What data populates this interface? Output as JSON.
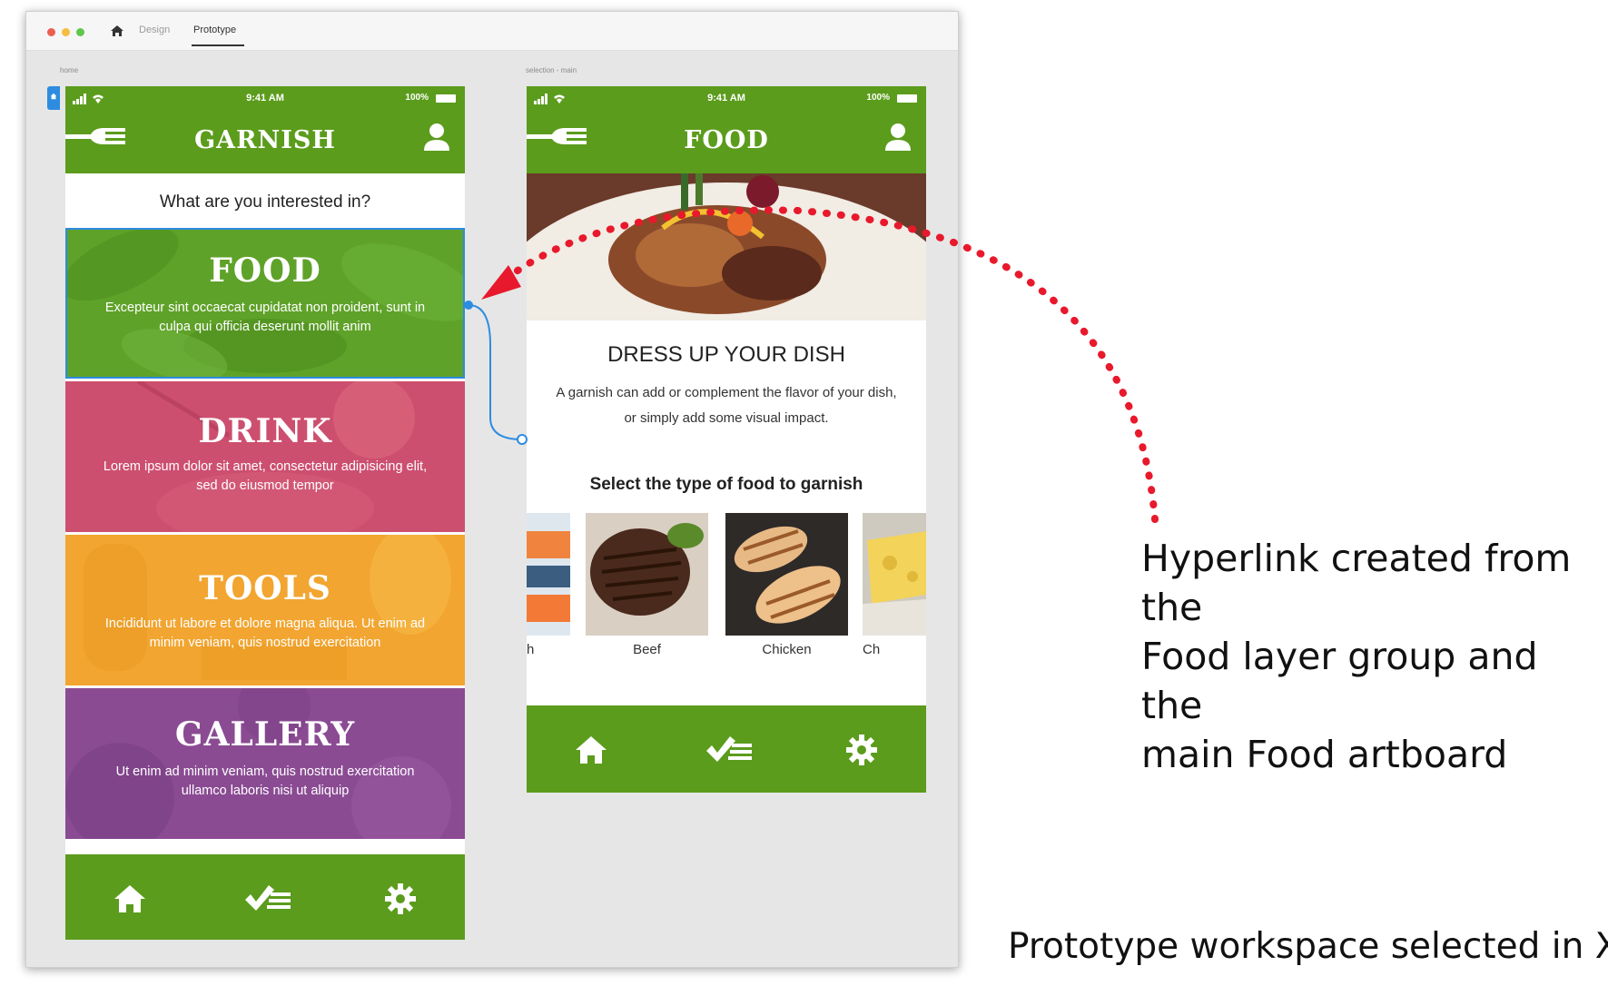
{
  "window": {
    "tabs": [
      "Design",
      "Prototype"
    ],
    "active_tab": "Prototype"
  },
  "artboards": {
    "home_name": "home",
    "food_name": "selection - main"
  },
  "status_bar": {
    "time": "9:41 AM",
    "battery": "100%"
  },
  "home_screen": {
    "title": "GARNISH",
    "question": "What are you interested in?",
    "tiles": [
      {
        "title": "FOOD",
        "desc": "Excepteur sint occaecat cupidatat non proident, sunt in culpa qui officia deserunt mollit anim",
        "color": "#5fa229"
      },
      {
        "title": "DRINK",
        "desc": "Lorem ipsum dolor sit amet, consectetur adipisicing elit, sed do eiusmod tempor",
        "color": "#cd4f6f"
      },
      {
        "title": "TOOLS",
        "desc": "Incididunt ut labore et dolore magna aliqua. Ut enim ad minim veniam, quis nostrud exercitation",
        "color": "#f2a530"
      },
      {
        "title": "GALLERY",
        "desc": "Ut enim ad minim veniam, quis nostrud exercitation ullamco laboris nisi ut aliquip",
        "color": "#8a4b93"
      }
    ]
  },
  "food_screen": {
    "title": "FOOD",
    "heading": "DRESS UP YOUR DISH",
    "body": "A garnish can add or complement the flavor of your dish, or simply add some visual impact.",
    "select_label": "Select the type of food to garnish",
    "food_types": [
      "h",
      "Beef",
      "Chicken",
      "Ch"
    ]
  },
  "tab_bar_icons": [
    "home-icon",
    "checklist-icon",
    "gear-icon"
  ],
  "annotations": {
    "hyperlink": [
      "Hyperlink created from the",
      "Food layer group and the",
      "main Food artboard"
    ],
    "workspace": "Prototype workspace selected in XD"
  },
  "colors": {
    "brand_green": "#5b9c1c",
    "link_blue": "#2d8ce0",
    "arrow_red": "#e8192c"
  }
}
